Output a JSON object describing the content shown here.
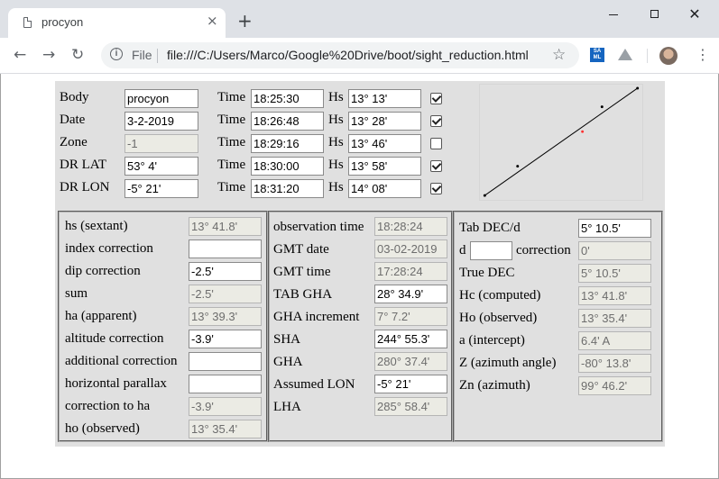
{
  "browser": {
    "tab_title": "procyon",
    "tab_close": "×",
    "new_tab": "+",
    "scheme": "File",
    "url": "file:///C:/Users/Marco/Google%20Drive/boot/sight_reduction.html",
    "ext_saml": "SA ML"
  },
  "top": {
    "body_label": "Body",
    "body_value": "procyon",
    "date_label": "Date",
    "date_value": "3-2-2019",
    "zone_label": "Zone",
    "zone_value": "-1",
    "drlat_label": "DR LAT",
    "drlat_value": "53° 4'",
    "drlon_label": "DR LON",
    "drlon_value": "-5° 21'",
    "time_label": "Time",
    "hs_label": "Hs",
    "observations": [
      {
        "time": "18:25:30",
        "hs": "13° 13'",
        "checked": true
      },
      {
        "time": "18:26:48",
        "hs": "13° 28'",
        "checked": true
      },
      {
        "time": "18:29:16",
        "hs": "13° 46'",
        "checked": false
      },
      {
        "time": "18:30:00",
        "hs": "13° 58'",
        "checked": true
      },
      {
        "time": "18:31:20",
        "hs": "14° 08'",
        "checked": true
      }
    ]
  },
  "altitude": {
    "hs_label": "hs (sextant)",
    "hs_value": "13° 41.8'",
    "index_label": "index correction",
    "index_value": "",
    "dip_label": "dip correction",
    "dip_value": "-2.5'",
    "sum_label": "sum",
    "sum_value": "-2.5'",
    "ha_label": "ha (apparent)",
    "ha_value": "13° 39.3'",
    "altcorr_label": "altitude correction",
    "altcorr_value": "-3.9'",
    "addcorr_label": "additional correction",
    "addcorr_value": "",
    "hp_label": "horizontal parallax",
    "hp_value": "",
    "corrha_label": "correction to ha",
    "corrha_value": "-3.9'",
    "ho_label": "ho (observed)",
    "ho_value": "13° 35.4'"
  },
  "time_angle": {
    "obs_label": "observation time",
    "obs_value": "18:28:24",
    "gmtdate_label": "GMT date",
    "gmtdate_value": "03-02-2019",
    "gmttime_label": "GMT time",
    "gmttime_value": "17:28:24",
    "tabgha_label": "TAB GHA",
    "tabgha_value": "28° 34.9'",
    "ghainc_label": "GHA increment",
    "ghainc_value": "7° 7.2'",
    "sha_label": "SHA",
    "sha_value": "244° 55.3'",
    "gha_label": "GHA",
    "gha_value": "280° 37.4'",
    "alon_label": "Assumed LON",
    "alon_value": "-5° 21'",
    "lha_label": "LHA",
    "lha_value": "285° 58.4'"
  },
  "reduction": {
    "tabdec_label": "Tab DEC/d",
    "tabdec_value": "5° 10.5'",
    "d_label": "d",
    "d_value": "",
    "corr_label": "correction",
    "corr_value": "0'",
    "truedec_label": "True DEC",
    "truedec_value": "5° 10.5'",
    "hc_label": "Hc (computed)",
    "hc_value": "13° 41.8'",
    "ho_label": "Ho (observed)",
    "ho_value": "13° 35.4'",
    "a_label": "a (intercept)",
    "a_value": "6.4' A",
    "z_label": "Z (azimuth angle)",
    "z_value": "-80° 13.8'",
    "zn_label": "Zn (azimuth)",
    "zn_value": "99° 46.2'"
  },
  "colors": {
    "mean_point": "#ff3030",
    "line": "#000000",
    "panel": "#e0e0e0"
  },
  "icons": {
    "page": "page-icon",
    "close": "close-icon",
    "back": "back-arrow-icon",
    "forward": "forward-arrow-icon",
    "reload": "reload-icon",
    "info": "info-icon",
    "star": "star-icon",
    "drive": "drive-icon",
    "menu": "menu-dots-icon"
  }
}
